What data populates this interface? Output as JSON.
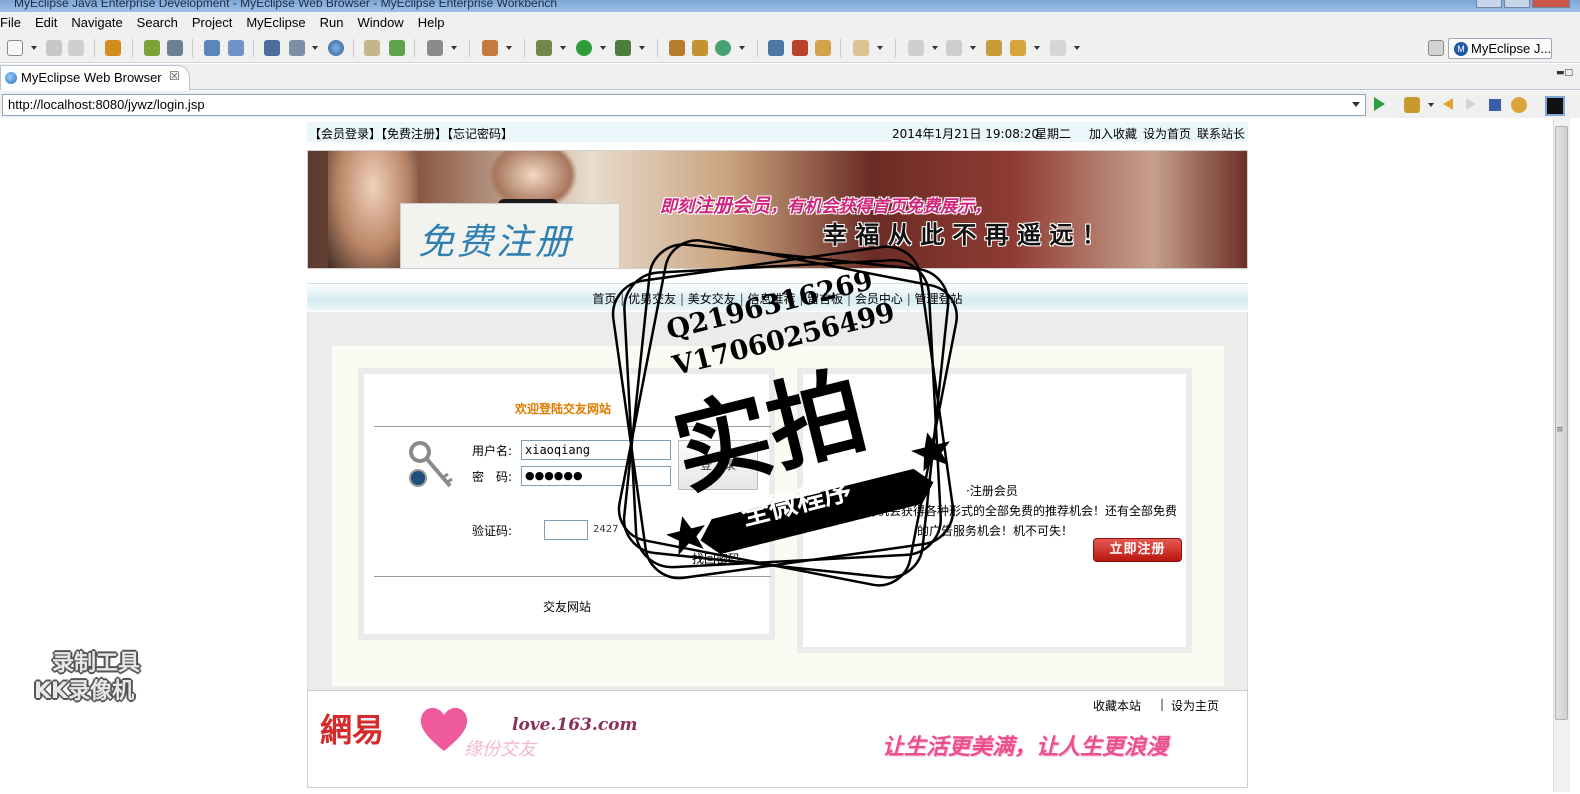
{
  "window": {
    "title": "MyEclipse Java Enterprise Development - MyEclipse Web Browser - MyEclipse Enterprise Workbench"
  },
  "menu": [
    "File",
    "Edit",
    "Navigate",
    "Search",
    "Project",
    "MyEclipse",
    "Run",
    "Window",
    "Help"
  ],
  "perspective": {
    "label": "MyEclipse J...",
    "icon": "M"
  },
  "editor_tab": {
    "label": "MyEclipse Web Browser",
    "close": "☒"
  },
  "url": "http://localhost:8080/jywz/login.jsp",
  "site": {
    "top_links": "【会员登录】【免费注册】【忘记密码】",
    "datetime": "2014年1月21日 19:08:20",
    "weekday": "星期二",
    "right_links": [
      "加入收藏",
      "设为首页",
      "联系站长"
    ],
    "banner": {
      "register_text": "免费注册",
      "slogan1_a": "即刻",
      "slogan1_b": "注册会员",
      "slogan1_c": "，有机会获得首页免费展示，",
      "slogan2": "幸 福 从 此 不 再 遥 远 ！"
    },
    "nav": [
      "首页",
      "优男交友",
      "美女交友",
      "信息推荐",
      "留言板",
      "会员中心",
      "管理登站"
    ],
    "login": {
      "welcome": "欢迎登陆交友网站",
      "username_label": "用户名:",
      "username_value": "xiaoqiang",
      "password_label": "密　码:",
      "password_value": "●●●●●●",
      "login_button": "登　录",
      "captcha_label": "验证码:",
      "captcha_value": "",
      "captcha_code": "2427",
      "forgot": "找回密码",
      "footer": "交友网站"
    },
    "register": {
      "title": "·注册会员",
      "line1": "将有机会获得各种形式的全部免费的推荐机会！还有全部免费",
      "line2": "的广告服务机会！机不可失！",
      "button": "立即注册"
    },
    "footer": {
      "brand": "網易",
      "brand_sub": "缘份交友",
      "domain": "love.163.com",
      "links": [
        "收藏本站",
        "设为主页"
      ],
      "slogan": "让生活更美满，让人生更浪漫"
    }
  },
  "stamp": {
    "line1": "Q2196316269",
    "line2": "V17060256499",
    "main": "实拍",
    "ribbon": "全微程序"
  },
  "watermark": [
    "录制工具",
    "KK录像机"
  ],
  "colors": {
    "accent_orange": "#e07b00",
    "register_red": "#c8201e",
    "banner_magenta": "#d0257c"
  }
}
